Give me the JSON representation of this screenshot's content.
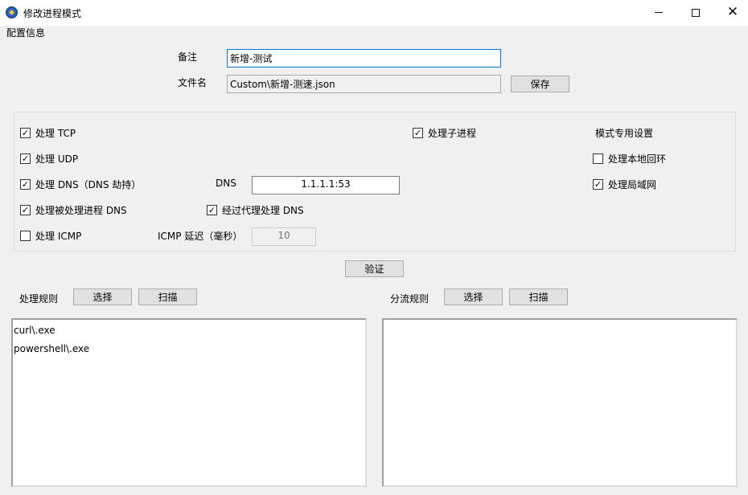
{
  "window": {
    "title": "修改进程模式",
    "minimize_icon": "minimize-icon",
    "maximize_icon": "maximize-icon",
    "close_icon": "close-icon",
    "close_glyph": "✕"
  },
  "config_section": {
    "heading": "配置信息",
    "remark_label": "备注",
    "remark_value": "新增-测试",
    "filename_label": "文件名",
    "filename_value": "Custom\\新增-测速.json",
    "save_button": "保存"
  },
  "options": {
    "check_mark": "✓",
    "handle_tcp": {
      "label": "处理 TCP",
      "checked": true
    },
    "handle_udp": {
      "label": "处理 UDP",
      "checked": true
    },
    "handle_dns": {
      "label": "处理 DNS（DNS 劫持）",
      "checked": true
    },
    "dns_label": "DNS",
    "dns_value": "1.1.1.1:53",
    "handle_processed_dns": {
      "label": "处理被处理进程 DNS",
      "checked": true
    },
    "proxy_dns": {
      "label": "经过代理处理 DNS",
      "checked": true
    },
    "handle_icmp": {
      "label": "处理 ICMP",
      "checked": false
    },
    "icmp_delay_label": "ICMP 延迟（毫秒）",
    "icmp_delay_value": "10",
    "handle_child_process": {
      "label": "处理子进程",
      "checked": true
    },
    "mode_settings_heading": "模式专用设置",
    "handle_loopback": {
      "label": "处理本地回环",
      "checked": false
    },
    "handle_lan": {
      "label": "处理局域网",
      "checked": true
    }
  },
  "verify_button": "验证",
  "process_rules": {
    "label": "处理规则",
    "select_button": "选择",
    "scan_button": "扫描",
    "items": [
      "curl\\.exe",
      "powershell\\.exe"
    ]
  },
  "bypass_rules": {
    "label": "分流规则",
    "select_button": "选择",
    "scan_button": "扫描",
    "items": []
  }
}
